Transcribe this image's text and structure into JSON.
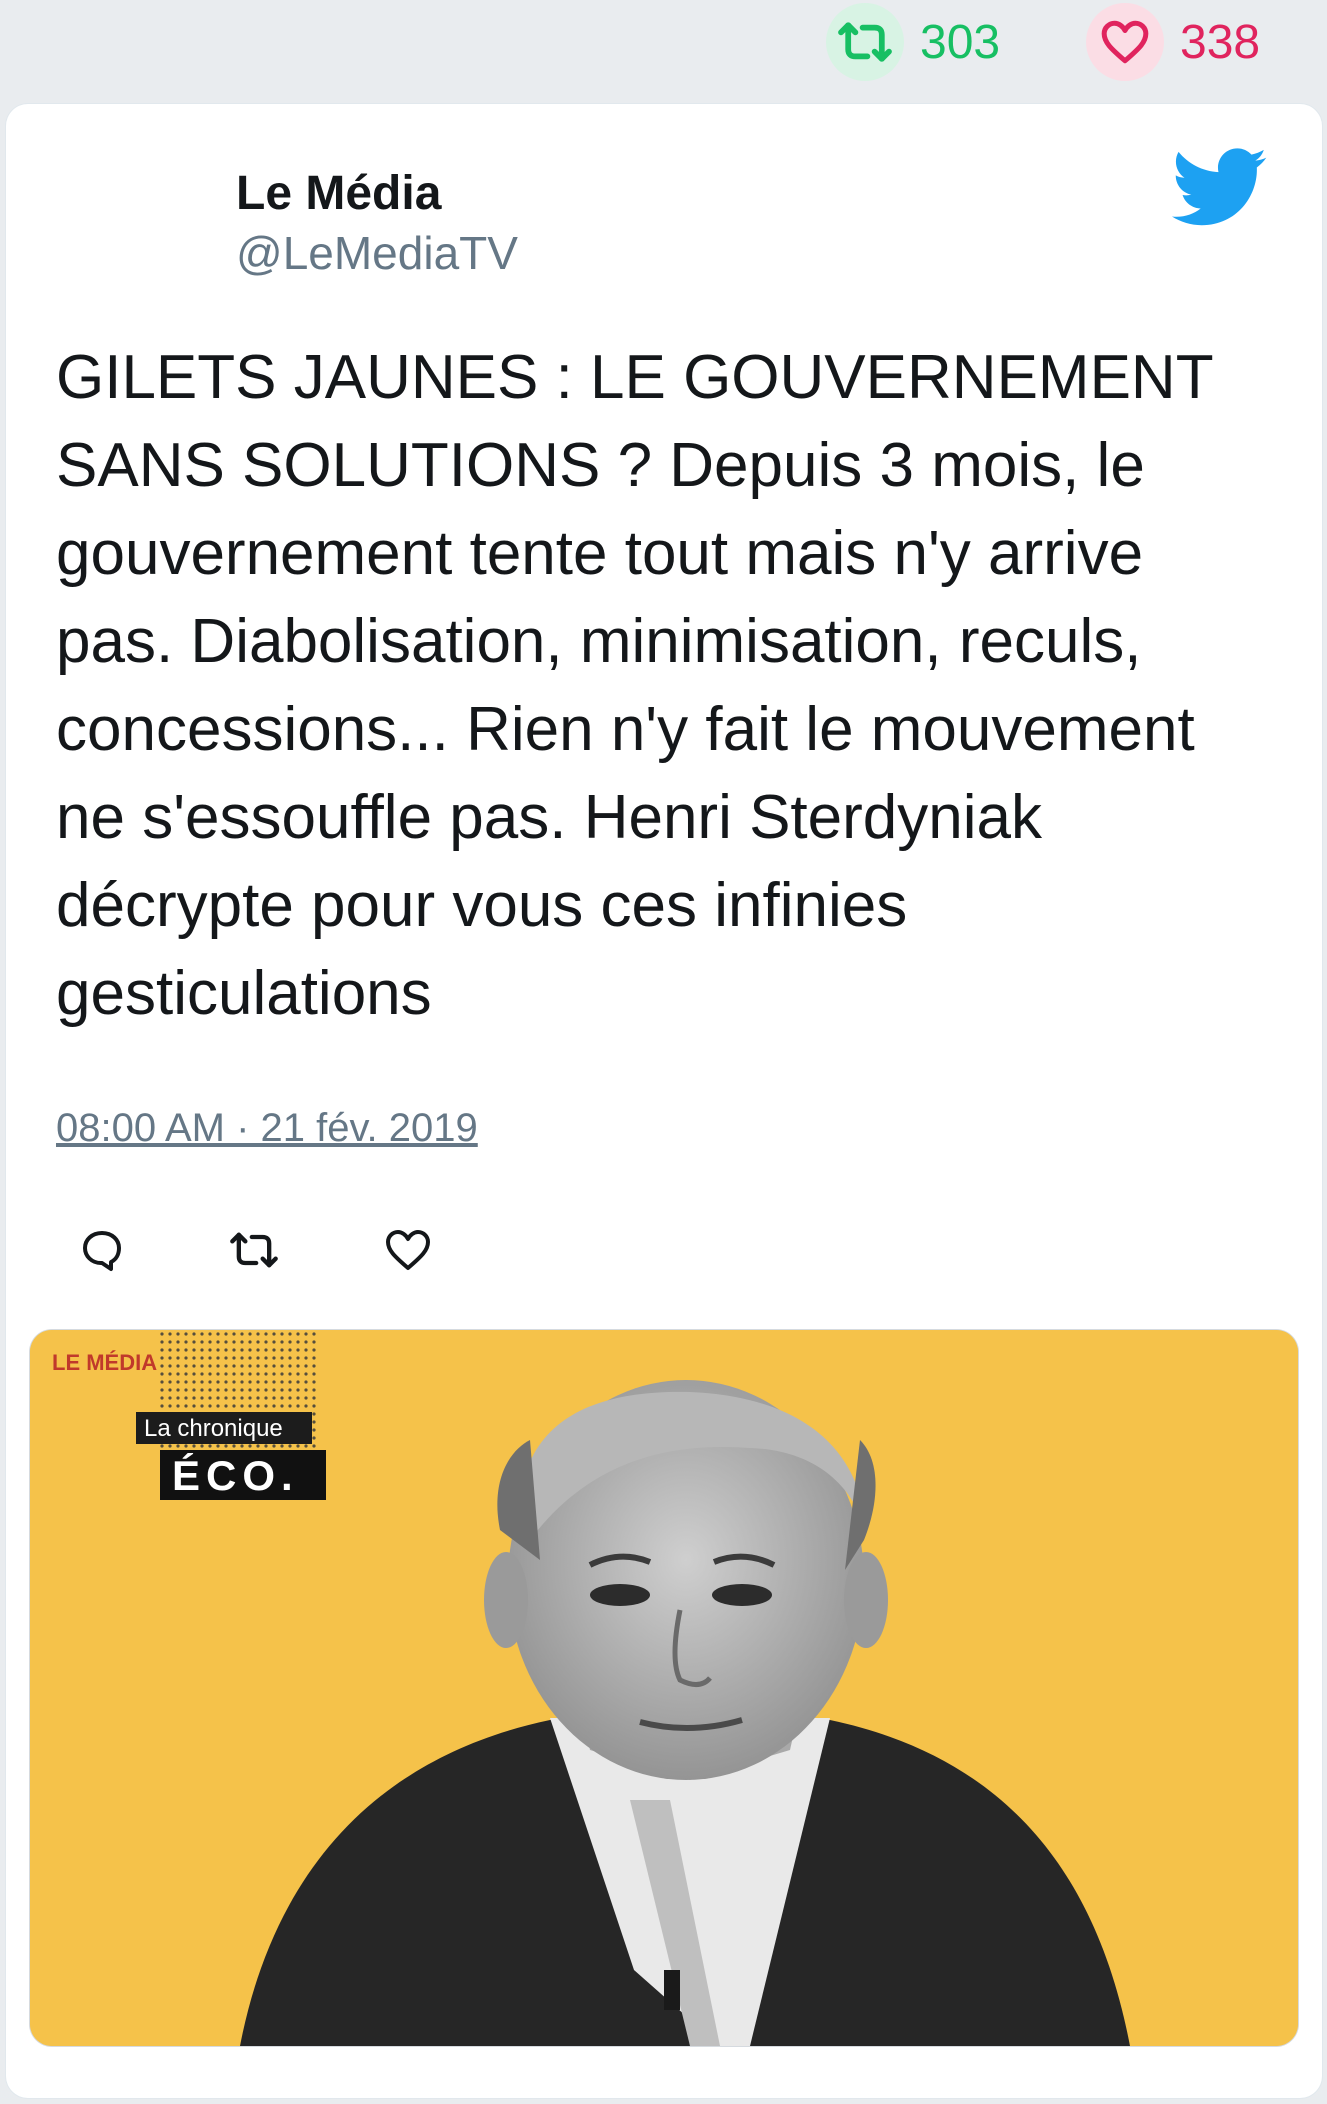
{
  "stats": {
    "retweets": "303",
    "likes": "338"
  },
  "tweet": {
    "author_name": "Le Média",
    "author_handle": "@LeMediaTV",
    "text": "GILETS JAUNES : LE GOUVERNEMENT SANS SOLUTIONS ? Depuis 3 mois, le gouvernement tente tout mais n'y arrive pas. Diabolisation, minimisation, reculs, concessions... Rien n'y fait le mouvement ne s'essouffle pas. Henri Sterdyniak décrypte pour vous ces infinies gesticulations",
    "timestamp": "08:00 AM · 21 fév. 2019"
  },
  "media": {
    "logo_text": "LE MÉDIA",
    "chronique_label": "La chronique",
    "eco_label": "ÉCO."
  },
  "colors": {
    "retweet": "#17bf63",
    "like": "#e0245e",
    "twitter_blue": "#1da1f2",
    "media_background": "#f5c24a"
  },
  "icons": [
    "retweet-icon",
    "heart-icon",
    "twitter-bird-icon",
    "reply-icon"
  ]
}
